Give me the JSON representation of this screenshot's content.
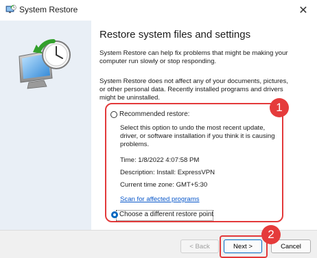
{
  "window": {
    "title": "System Restore",
    "close_glyph": "✕"
  },
  "icons": {
    "app": "system-restore-icon",
    "hero": "monitor-clock-restore-icon",
    "close": "close-icon"
  },
  "heading": "Restore system files and settings",
  "paragraphs": [
    "System Restore can help fix problems that might be making your computer run slowly or stop responding.",
    "System Restore does not affect any of your documents, pictures, or other personal data. Recently installed programs and drivers might be uninstalled."
  ],
  "options": {
    "recommended": {
      "label": "Recommended restore:",
      "selected": false,
      "description": "Select this option to undo the most recent update, driver, or software installation if you think it is causing problems.",
      "time": "Time: 1/8/2022 4:07:58 PM",
      "desc": "Description: Install: ExpressVPN",
      "tz": "Current time zone: GMT+5:30",
      "scan_link": "Scan for affected programs"
    },
    "different": {
      "label": "Choose a different restore point",
      "selected": true
    }
  },
  "buttons": {
    "back": "< Back",
    "next": "Next >",
    "cancel": "Cancel"
  },
  "annotations": {
    "badge1": "1",
    "badge2": "2",
    "color": "#e53b3b"
  },
  "colors": {
    "accent": "#0067c0",
    "left_panel": "#e9eff6",
    "link": "#0a58ca"
  }
}
